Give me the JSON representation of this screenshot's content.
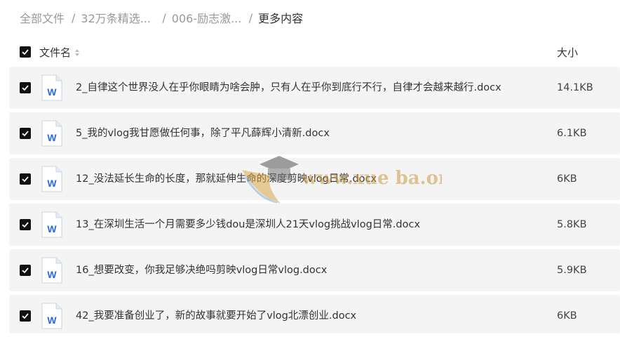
{
  "breadcrumb": {
    "items": [
      "全部文件",
      "32万条精选...",
      "006-励志激...",
      "更多内容"
    ],
    "separator": "/"
  },
  "table": {
    "header": {
      "name_label": "文件名",
      "size_label": "大小"
    },
    "rows": [
      {
        "name": "2_自律这个世界没人在乎你眼睛为啥会肿，只有人在乎你到底行不行，自律才会越来越行.docx",
        "size": "14.1KB"
      },
      {
        "name": "5_我的vlog我甘愿做任何事，除了平凡薛辉小清新.docx",
        "size": "6.1KB"
      },
      {
        "name": "12_没法延长生命的长度，那就延伸生命的深度剪映vlog日常.docx",
        "size": "6KB"
      },
      {
        "name": "13_在深圳生活一个月需要多少钱dou是深圳人21天vlog挑战vlog日常.docx",
        "size": "5.8KB"
      },
      {
        "name": "16_想要改变，你我足够决绝吗剪映vlog日常vlog.docx",
        "size": "5.9KB"
      },
      {
        "name": "42_我要准备创业了，新的故事就要开始了vlog北漂创业.docx",
        "size": "6KB"
      }
    ]
  },
  "watermark": {
    "text": "www.xue ba.org"
  },
  "colors": {
    "row_bg": "#f4f4f5",
    "checkbox": "#111111",
    "word_blue": "#2b6bd6"
  },
  "icons": {
    "file": "word-doc-icon",
    "checkbox": "checkbox-checked-icon",
    "sort": "sort-icon"
  }
}
